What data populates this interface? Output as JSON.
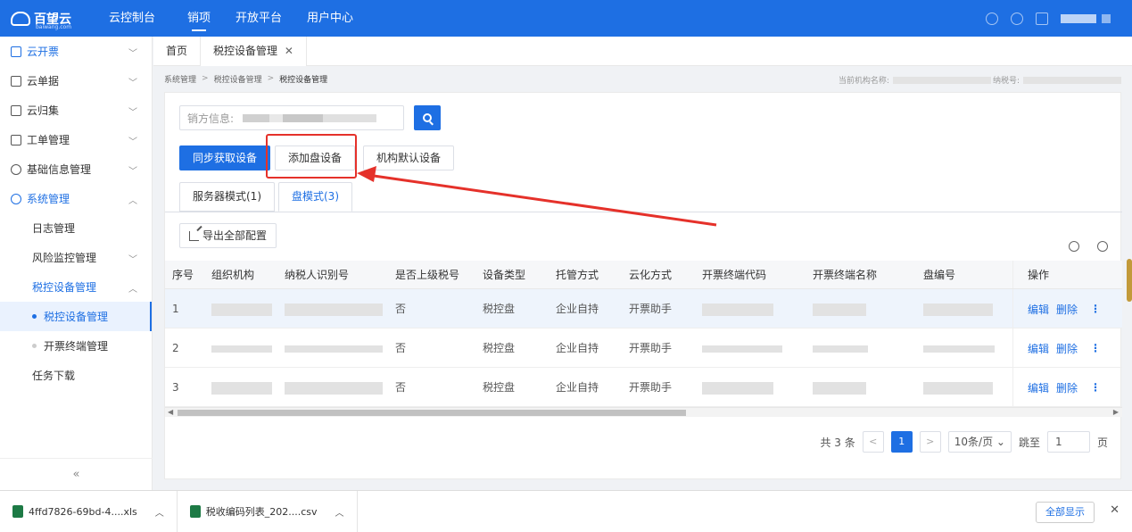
{
  "topbar": {
    "brand": "百望云",
    "brand_sub": "baiwang.com",
    "console": "云控制台",
    "nav": [
      "销项",
      "开放平台",
      "用户中心"
    ],
    "active_nav": "销项"
  },
  "sidebar": {
    "items": [
      {
        "label": "云开票",
        "icon": "invoice-icon",
        "expanded": false
      },
      {
        "label": "云单据",
        "icon": "document-icon",
        "expanded": false
      },
      {
        "label": "云归集",
        "icon": "box-icon",
        "expanded": false
      },
      {
        "label": "工单管理",
        "icon": "clipboard-icon",
        "expanded": false
      },
      {
        "label": "基础信息管理",
        "icon": "info-icon",
        "expanded": false
      },
      {
        "label": "系统管理",
        "icon": "settings-icon",
        "expanded": true
      }
    ],
    "sub": {
      "log": "日志管理",
      "risk": "风险监控管理",
      "device": "税控设备管理",
      "device_leaf": "税控设备管理",
      "terminal_leaf": "开票终端管理",
      "task": "任务下载"
    },
    "collapse": "«"
  },
  "tabs": {
    "home": "首页",
    "current": "税控设备管理",
    "close": "✕"
  },
  "breadcrumb": {
    "items": [
      "系统管理",
      "税控设备管理",
      "税控设备管理"
    ],
    "sep": ">",
    "org_label": "当前机构名称:",
    "tax_label": "纳税号:"
  },
  "search": {
    "label": "销方信息:"
  },
  "buttons": {
    "sync": "同步获取设备",
    "add": "添加盘设备",
    "default": "机构默认设备",
    "export": "导出全部配置"
  },
  "mode_tabs": [
    {
      "label": "服务器模式(1)",
      "active": false
    },
    {
      "label": "盘模式(3)",
      "active": true
    }
  ],
  "table": {
    "columns": [
      "序号",
      "组织机构",
      "纳税人识别号",
      "是否上级税号",
      "设备类型",
      "托管方式",
      "云化方式",
      "开票终端代码",
      "开票终端名称",
      "盘编号",
      "操作"
    ],
    "rows": [
      {
        "no": "1",
        "superior": "否",
        "type": "税控盘",
        "host": "企业自持",
        "cloud": "开票助手"
      },
      {
        "no": "2",
        "superior": "否",
        "type": "税控盘",
        "host": "企业自持",
        "cloud": "开票助手"
      },
      {
        "no": "3",
        "superior": "否",
        "type": "税控盘",
        "host": "企业自持",
        "cloud": "开票助手"
      }
    ],
    "ops": {
      "edit": "编辑",
      "delete": "删除",
      "more": "⋮"
    }
  },
  "pager": {
    "total": "共 3 条",
    "prev": "<",
    "page": "1",
    "next": ">",
    "size": "10条/页",
    "goto": "跳至",
    "goto_value": "1",
    "unit": "页"
  },
  "downloads": {
    "files": [
      "4ffd7826-69bd-4....xls",
      "税收编码列表_202....csv"
    ],
    "show_all": "全部显示",
    "close": "✕"
  },
  "colors": {
    "brand": "#1e6fe3",
    "annotation": "#e5312a"
  }
}
